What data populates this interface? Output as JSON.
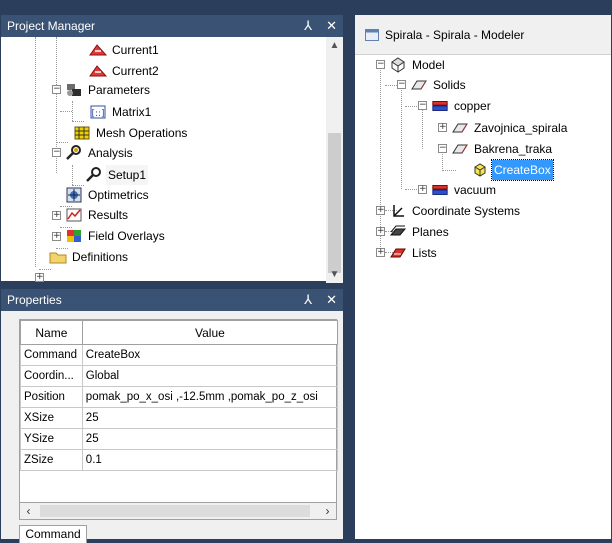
{
  "project_manager": {
    "title": "Project Manager",
    "pin": "⅄",
    "close": "✕",
    "items": [
      {
        "label": "Current1",
        "icon": "excitation-icon"
      },
      {
        "label": "Current2",
        "icon": "excitation-icon"
      },
      {
        "label": "Parameters",
        "icon": "parameters-icon"
      },
      {
        "label": "Matrix1",
        "icon": "matrix-icon"
      },
      {
        "label": "Mesh Operations",
        "icon": "mesh-icon"
      },
      {
        "label": "Analysis",
        "icon": "analysis-icon"
      },
      {
        "label": "Setup1",
        "icon": "setup-icon"
      },
      {
        "label": "Optimetrics",
        "icon": "optimetrics-icon"
      },
      {
        "label": "Results",
        "icon": "results-icon"
      },
      {
        "label": "Field Overlays",
        "icon": "field-overlays-icon"
      },
      {
        "label": "Definitions",
        "icon": "folder-icon"
      }
    ]
  },
  "properties": {
    "title": "Properties",
    "pin": "⅄",
    "close": "✕",
    "headers": {
      "name": "Name",
      "value": "Value"
    },
    "rows": [
      {
        "name": "Command",
        "value": "CreateBox"
      },
      {
        "name": "Coordin...",
        "value": "Global"
      },
      {
        "name": "Position",
        "value": "pomak_po_x_osi ,-12.5mm ,pomak_po_z_osi"
      },
      {
        "name": "XSize",
        "value": "25"
      },
      {
        "name": "YSize",
        "value": "25"
      },
      {
        "name": "ZSize",
        "value": "0.1"
      }
    ],
    "tab": "Command"
  },
  "modeler": {
    "title": "Spirala - Spirala - Modeler",
    "items": [
      {
        "label": "Model"
      },
      {
        "label": "Solids"
      },
      {
        "label": "copper"
      },
      {
        "label": "Zavojnica_spirala"
      },
      {
        "label": "Bakrena_traka"
      },
      {
        "label": "CreateBox"
      },
      {
        "label": "vacuum"
      },
      {
        "label": "Coordinate Systems"
      },
      {
        "label": "Planes"
      },
      {
        "label": "Lists"
      }
    ],
    "colors": {
      "selection": "#3399ff",
      "copper": "#d9322b",
      "vacuum": "#d9322b"
    }
  },
  "expander_plus": "+",
  "expander_minus": "−"
}
